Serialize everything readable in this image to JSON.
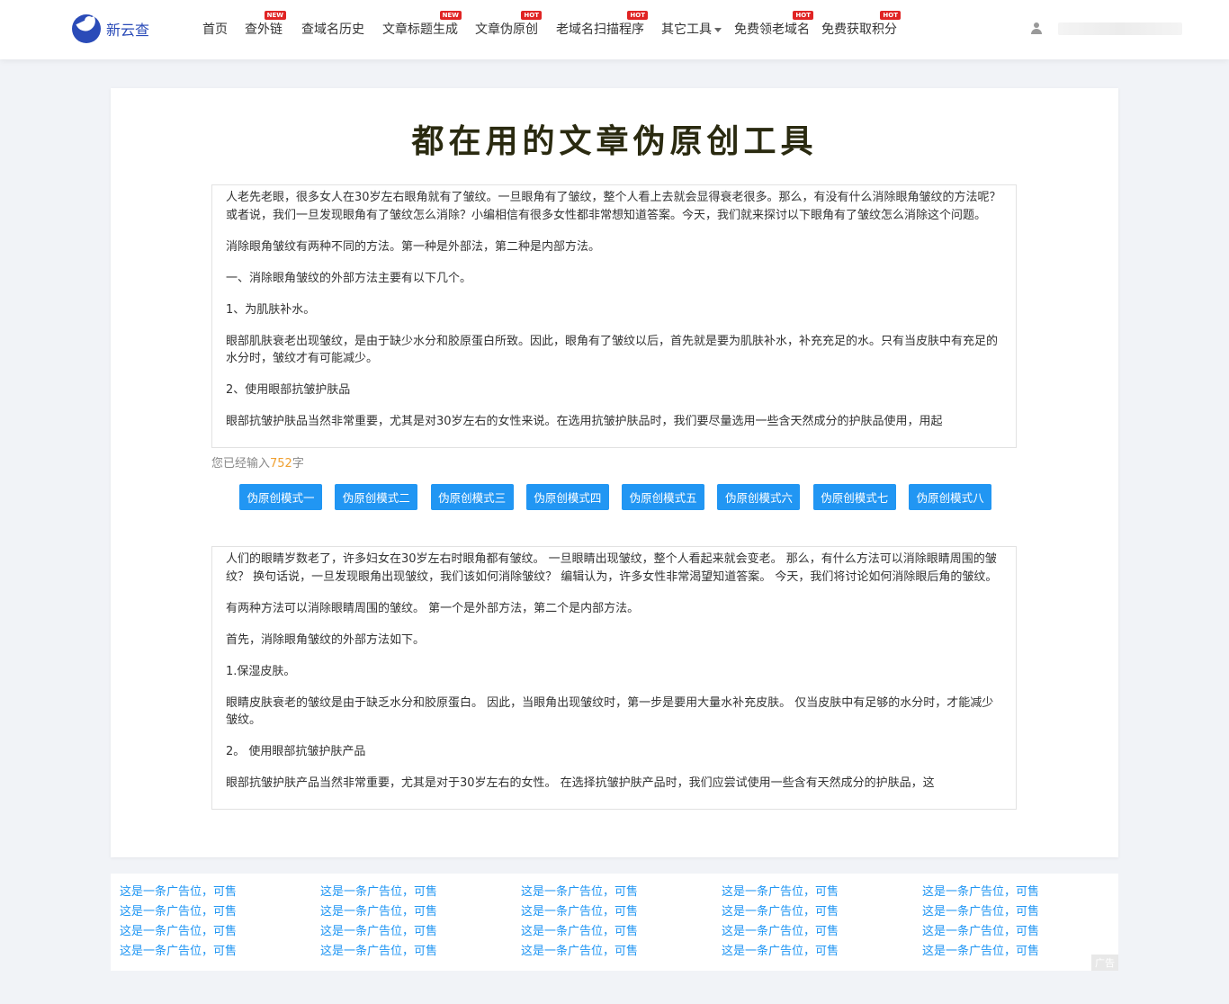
{
  "header": {
    "logo_text": "新云查",
    "nav": [
      {
        "label": "首页",
        "badge": ""
      },
      {
        "label": "查外链",
        "badge": "NEW"
      },
      {
        "label": "查域名历史",
        "badge": ""
      },
      {
        "label": "文章标题生成",
        "badge": "NEW"
      },
      {
        "label": "文章伪原创",
        "badge": "HOT"
      },
      {
        "label": "老域名扫描程序",
        "badge": "HOT"
      },
      {
        "label": "其它工具",
        "badge": ""
      },
      {
        "label": "免费领老域名",
        "badge": "HOT"
      },
      {
        "label": "免费获取积分",
        "badge": "HOT"
      }
    ]
  },
  "main": {
    "title": "都在用的文章伪原创工具",
    "input_paragraphs": [
      "人老先老眼，很多女人在30岁左右眼角就有了皱纹。一旦眼角有了皱纹，整个人看上去就会显得衰老很多。那么，有没有什么消除眼角皱纹的方法呢？或者说，我们一旦发现眼角有了皱纹怎么消除？小编相信有很多女性都非常想知道答案。今天，我们就来探讨以下眼角有了皱纹怎么消除这个问题。",
      "消除眼角皱纹有两种不同的方法。第一种是外部法，第二种是内部方法。",
      "一、消除眼角皱纹的外部方法主要有以下几个。",
      "1、为肌肤补水。",
      "眼部肌肤衰老出现皱纹，是由于缺少水分和胶原蛋白所致。因此，眼角有了皱纹以后，首先就是要为肌肤补水，补充充足的水。只有当皮肤中有充足的水分时，皱纹才有可能减少。",
      "2、使用眼部抗皱护肤品",
      "眼部抗皱护肤品当然非常重要，尤其是对30岁左右的女性来说。在选用抗皱护肤品时，我们要尽量选用一些含天然成分的护肤品使用，用起"
    ],
    "count_prefix": "您已经输入",
    "count_value": "752",
    "count_suffix": "字",
    "mode_buttons": [
      "伪原创模式一",
      "伪原创模式二",
      "伪原创模式三",
      "伪原创模式四",
      "伪原创模式五",
      "伪原创模式六",
      "伪原创模式七",
      "伪原创模式八"
    ],
    "output_paragraphs": [
      "人们的眼睛岁数老了，许多妇女在30岁左右时眼角都有皱纹。 一旦眼睛出现皱纹，整个人看起来就会变老。 那么，有什么方法可以消除眼睛周围的皱纹？ 换句话说，一旦发现眼角出现皱纹，我们该如何消除皱纹？ 编辑认为，许多女性非常渴望知道答案。 今天，我们将讨论如何消除眼后角的皱纹。",
      "有两种方法可以消除眼睛周围的皱纹。 第一个是外部方法，第二个是内部方法。",
      "首先，消除眼角皱纹的外部方法如下。",
      " 1.保湿皮肤。",
      "眼睛皮肤衰老的皱纹是由于缺乏水分和胶原蛋白。 因此，当眼角出现皱纹时，第一步是要用大量水补充皮肤。 仅当皮肤中有足够的水分时，才能减少皱纹。",
      " 2。 使用眼部抗皱护肤产品",
      "眼部抗皱护肤产品当然非常重要，尤其是对于30岁左右的女性。 在选择抗皱护肤产品时，我们应尝试使用一些含有天然成分的护肤品，这"
    ]
  },
  "ads": {
    "link_text": "这是一条广告位，可售",
    "count": 20,
    "tag": "广告"
  },
  "colors": {
    "accent": "#2196f3",
    "badge": "#e02424",
    "count_highlight": "#f0a030",
    "brand": "#2a4bb8"
  }
}
